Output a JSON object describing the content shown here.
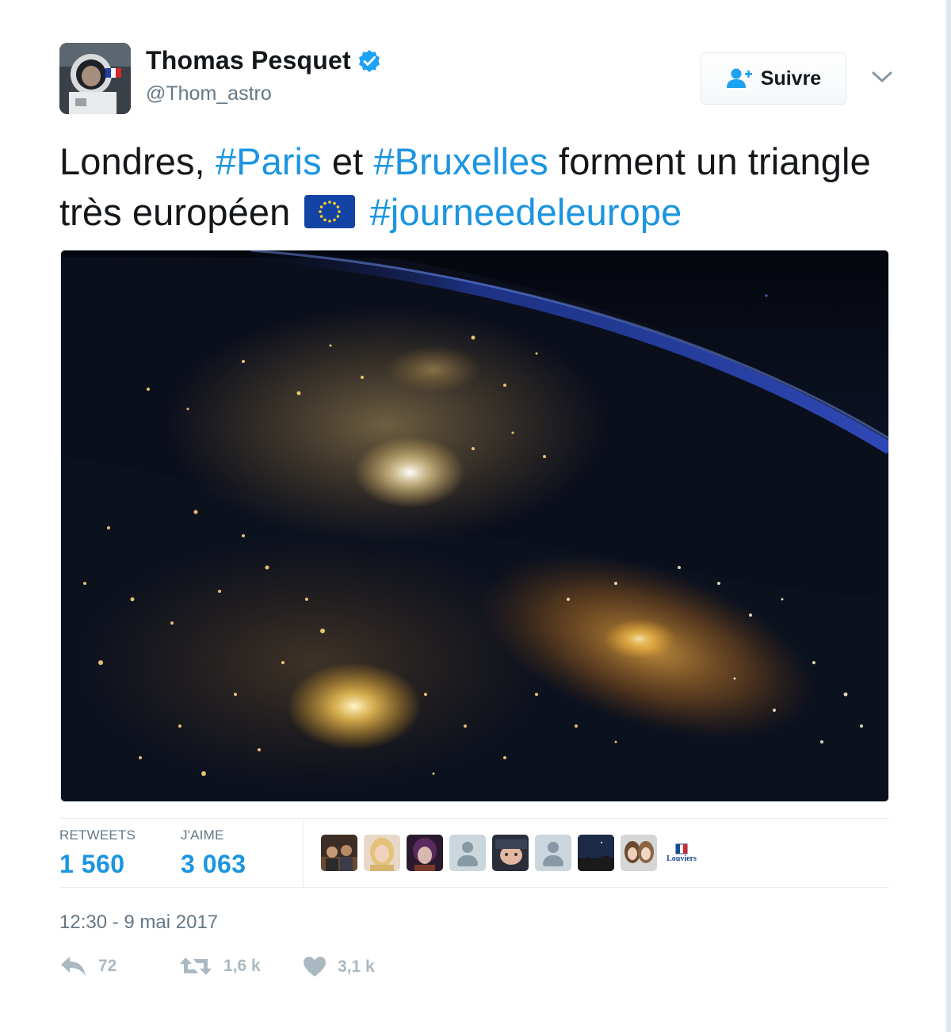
{
  "author": {
    "display_name": "Thomas Pesquet",
    "handle": "@Thom_astro",
    "verified": true
  },
  "follow_button": {
    "label": "Suivre"
  },
  "tweet": {
    "text_parts": {
      "p1": "Londres, ",
      "h1": "#Paris",
      "p2": " et ",
      "h2": "#Bruxelles",
      "p3": " forment un triangle très européen ",
      "h3": "#journeedeleurope"
    },
    "emoji": "eu-flag-icon"
  },
  "stats": {
    "retweets_label": "RETWEETS",
    "retweets_value": "1 560",
    "likes_label": "J'AIME",
    "likes_value": "3 063"
  },
  "likers": {
    "logo_text": "Louviers"
  },
  "timestamp": "12:30 - 9 mai 2017",
  "actions": {
    "reply_count": "72",
    "retweet_count": "1,6 k",
    "like_count": "3,1 k"
  },
  "colors": {
    "link": "#1b95e0",
    "text": "#14171a",
    "muted": "#657786",
    "action": "#aab8c2",
    "verified": "#1da1f2"
  }
}
